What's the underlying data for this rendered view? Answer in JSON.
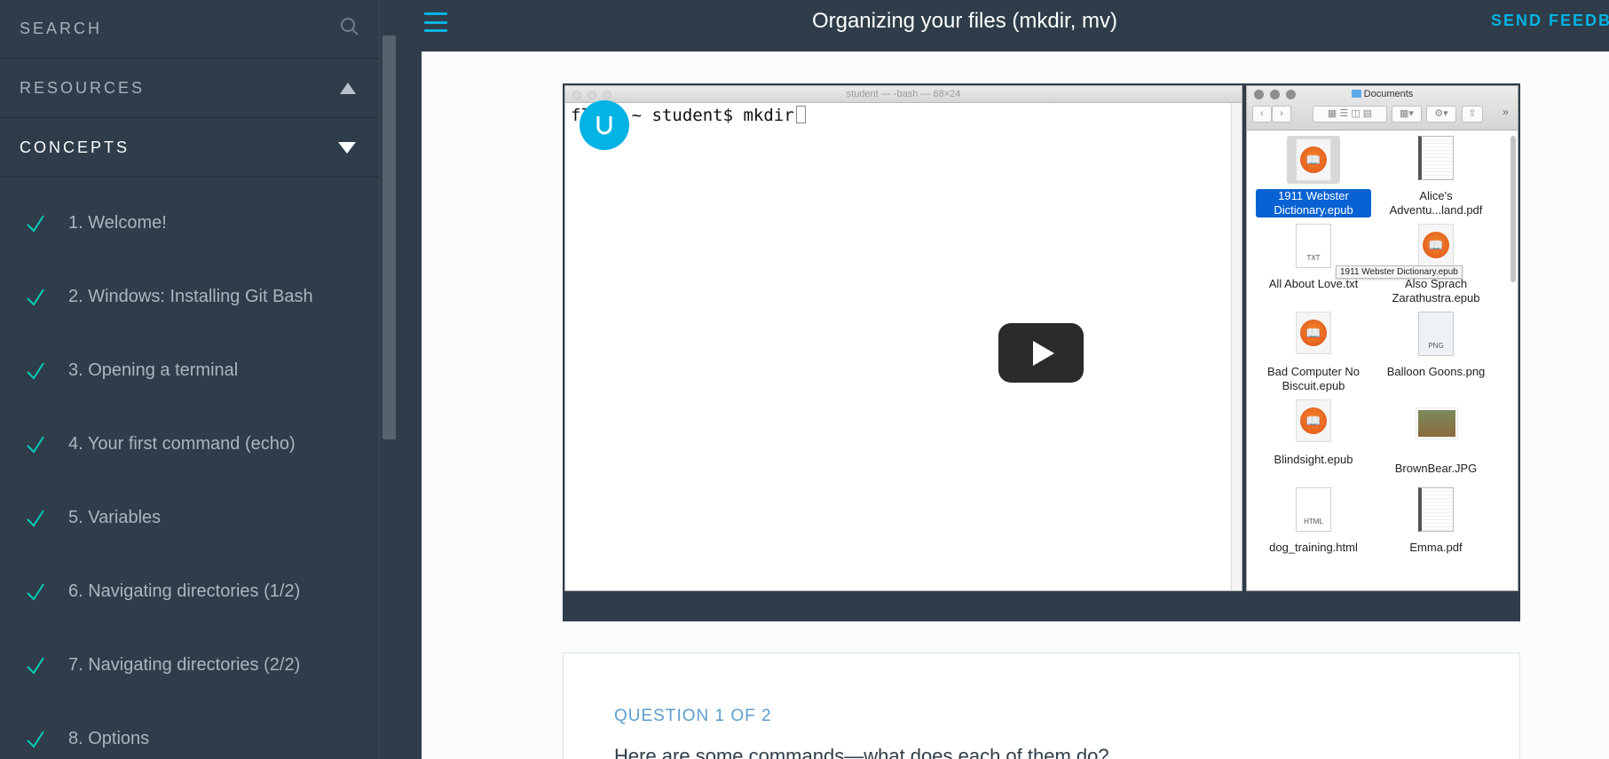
{
  "sidebar": {
    "search_label": "SEARCH",
    "resources_label": "RESOURCES",
    "concepts_label": "CONCEPTS",
    "check_color": "#02ccba",
    "lessons": [
      {
        "label": "1. Welcome!",
        "completed": true
      },
      {
        "label": "2. Windows: Installing Git Bash",
        "completed": true
      },
      {
        "label": "3. Opening a terminal",
        "completed": true
      },
      {
        "label": "4. Your first command (echo)",
        "completed": true
      },
      {
        "label": "5. Variables",
        "completed": true
      },
      {
        "label": "6. Navigating directories (1/2)",
        "completed": true
      },
      {
        "label": "7. Navigating directories (2/2)",
        "completed": true
      },
      {
        "label": "8. Options",
        "completed": true
      }
    ]
  },
  "header": {
    "title": "Organizing your files (mkdir, mv)",
    "feedback_label": "SEND FEEDB",
    "accent_color": "#02b3e4"
  },
  "video": {
    "terminal_title": "student — -bash — 68×24",
    "terminal_prompt": "fl    ~ student$ mkdir",
    "finder_title": "Documents",
    "tooltip": "1911 Webster Dictionary.epub",
    "files": [
      {
        "name": "1911 Webster Dictionary.epub",
        "kind": "epub",
        "selected": true
      },
      {
        "name": "Alice's Adventu...land.pdf",
        "kind": "pdf"
      },
      {
        "name": "All About Love.txt",
        "kind": "txt",
        "tag": "TXT"
      },
      {
        "name": "Also Sprach Zarathustra.epub",
        "kind": "epub"
      },
      {
        "name": "Bad Computer No Biscuit.epub",
        "kind": "epub"
      },
      {
        "name": "Balloon Goons.png",
        "kind": "png",
        "tag": "PNG"
      },
      {
        "name": "Blindsight.epub",
        "kind": "epub"
      },
      {
        "name": "BrownBear.JPG",
        "kind": "jpg"
      },
      {
        "name": "dog_training.html",
        "kind": "html",
        "tag": "HTML"
      },
      {
        "name": "Emma.pdf",
        "kind": "pdf"
      }
    ]
  },
  "question": {
    "label": "QUESTION 1 OF 2",
    "text": "Here are some commands—what does each of them do?"
  }
}
